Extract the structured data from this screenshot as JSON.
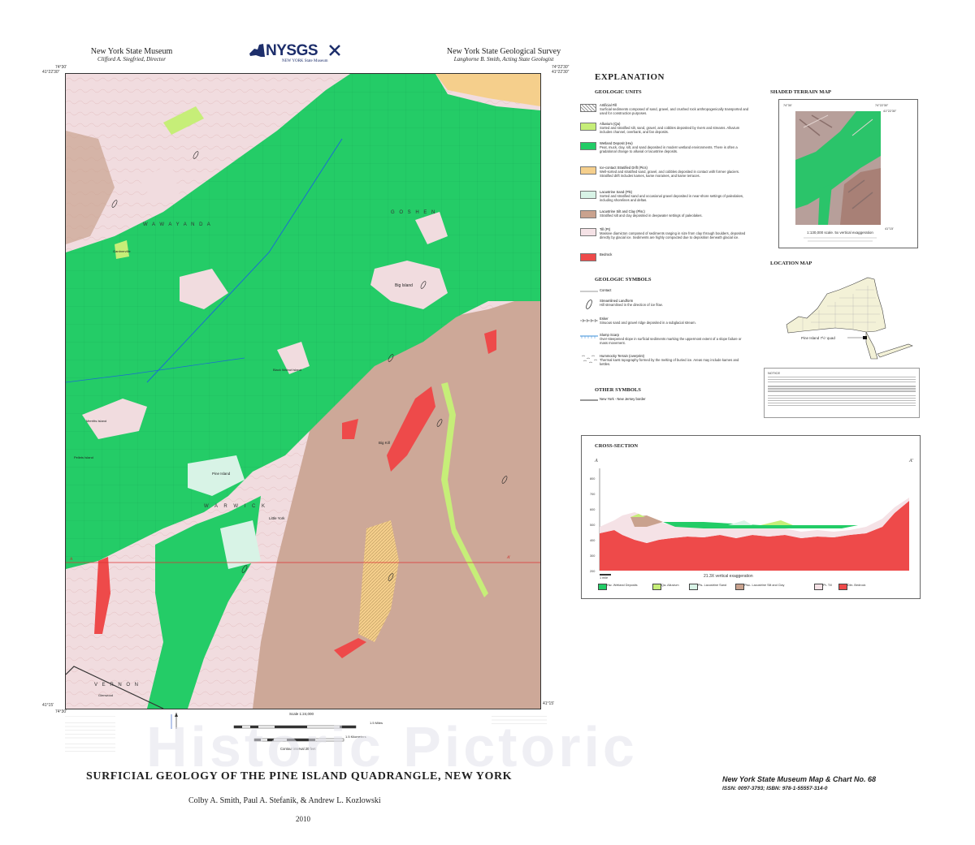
{
  "header": {
    "left_org": "New York State Museum",
    "left_person": "Clifford A. Siegfried, Director",
    "logo_text": "NYSGS",
    "logo_sub": "NEW YORK State Museum",
    "right_org": "New York State Geological Survey",
    "right_person": "Langhorne B. Smith, Acting State Geologist"
  },
  "map": {
    "coords": {
      "tl_lat": "41°22'30\"",
      "tl_lon": "74°30'",
      "tr_lat": "41°22'30\"",
      "tr_lon": "74°22'30\"",
      "bl_lat": "41°15'",
      "bl_lon": "74°30'",
      "br_lat": "41°15'"
    },
    "place_labels": [
      "W A W A Y A N D A",
      "G O S H E N",
      "W A R W I C K",
      "V E R N O N",
      "Big Island",
      "Pine Island",
      "Little York",
      "Black Walnut Island",
      "Big Kill",
      "Glenwood",
      "Gardnerville",
      "Pellets Island",
      "Merritts Island"
    ],
    "scale_label": "Scale 1:24,000",
    "miles_label": "1.5 Miles",
    "km_label": "1.5 Kilometers",
    "contour_label": "Contour interval 20 feet",
    "marker_a": "A",
    "marker_a_prime": "A'"
  },
  "explanation": {
    "title": "EXPLANATION",
    "units_heading": "GEOLOGIC UNITS",
    "units": [
      {
        "name": "Artificial Fill",
        "desc": "Surficial sediments composed of sand, gravel, and crushed rock anthropogenically transported and used for construction purposes.",
        "color": "#cfcfcf",
        "hatch": true
      },
      {
        "name": "Alluvium (Qa)",
        "desc": "Sorted and stratified silt, sand, gravel, and cobbles deposited by rivers and streams. Alluvium includes channel, overbank, and fan deposits.",
        "color": "#c6ee78"
      },
      {
        "name": "Wetland Deposit (Hw)",
        "desc": "Peat, muck, clay, silt, and sand deposited in modern wetland environments. There is often a gradational change to alluvial or lacustrine deposits.",
        "color": "#22cc66"
      },
      {
        "name": "Ice-contact Stratified Drift (Pics)",
        "desc": "Well-sorted and stratified sand, gravel, and cobbles deposited in contact with former glaciers. Stratified drift includes kames, kame moraines, and kame terraces.",
        "color": "#f5cf8c"
      },
      {
        "name": "Lacustrine Sand (Pls)",
        "desc": "Sorted and stratified sand and occasional gravel deposited in near-shore settings of paleolakes, including shorelines and deltas.",
        "color": "#d8f3e6"
      },
      {
        "name": "Lacustrine Silt and Clay (Plsc)",
        "desc": "Stratified silt and clay deposited in deepwater settings of paleolakes.",
        "color": "#c9a28e"
      },
      {
        "name": "Till (Pt)",
        "desc": "Massive diamicton composed of sediments ranging in size from clay through boulders, deposited directly by glacial ice. Sediments are highly compacted due to deposition beneath glacial ice.",
        "color": "#f5e2e6"
      },
      {
        "name": "Bedrock",
        "desc": "",
        "color": "#ee4a4a"
      }
    ],
    "symbols_heading": "GEOLOGIC SYMBOLS",
    "symbols": [
      {
        "name": "Contact",
        "desc": ""
      },
      {
        "name": "Streamlined Landform",
        "desc": "Hill streamlined in the direction of ice flow."
      },
      {
        "name": "Esker",
        "desc": "Sinuous sand and gravel ridge deposited in a subglacial stream."
      },
      {
        "name": "Slump Scarp",
        "desc": "Over-steepened slope in surficial sediments marking the uppermost extent of a slope failure or mass movement."
      },
      {
        "name": "Hummocky Terrain (overprint)",
        "desc": "Thermal karst topography formed by the melting of buried ice. Areas may include kames and kettles."
      }
    ],
    "other_heading": "OTHER SYMBOLS",
    "other": [
      {
        "name": "New York - New Jersey border"
      }
    ]
  },
  "terrain": {
    "heading": "SHADED TERRAIN MAP",
    "lon_left": "74°30'",
    "lon_right": "74°22'30\"",
    "lat_top": "41°22'30\"",
    "lat_bottom": "41°15'",
    "caption": "1:130,000 scale. 5x vertical exaggeration"
  },
  "location": {
    "heading": "LOCATION MAP",
    "label": "Pine Island 7½' quad"
  },
  "notice": {
    "heading": "NOTICE"
  },
  "cross_section": {
    "heading": "CROSS-SECTION",
    "left_label": "A",
    "right_label": "A'",
    "y_ticks": [
      "800",
      "700",
      "600",
      "500",
      "400",
      "300",
      "200"
    ],
    "scale_label": "1 mile",
    "exaggeration": "21.3X vertical exaggeration",
    "legend": [
      {
        "label": "Hw- Wetland Deposits",
        "color": "#22cc66"
      },
      {
        "label": "Qa- Alluvium",
        "color": "#c6ee78"
      },
      {
        "label": "Pls- Lacustrine Sand",
        "color": "#d8f3e6"
      },
      {
        "label": "Plsc- Lacustrine Silt and Clay",
        "color": "#c9a28e"
      },
      {
        "label": "Pt- Till",
        "color": "#f5e2e6"
      },
      {
        "label": "Dbr- Bedrock",
        "color": "#ee4a4a"
      }
    ]
  },
  "footer": {
    "title": "SURFICIAL GEOLOGY OF THE PINE ISLAND QUADRANGLE, NEW YORK",
    "authors": "Colby A. Smith, Paul A. Stefanik, & Andrew L. Kozlowski",
    "year": "2010",
    "series": "New York State Museum Map & Chart No. 68",
    "isbn": "ISSN: 0097-3793; ISBN: 978-1-55557-314-0",
    "watermark": "Historic Pictoric"
  }
}
